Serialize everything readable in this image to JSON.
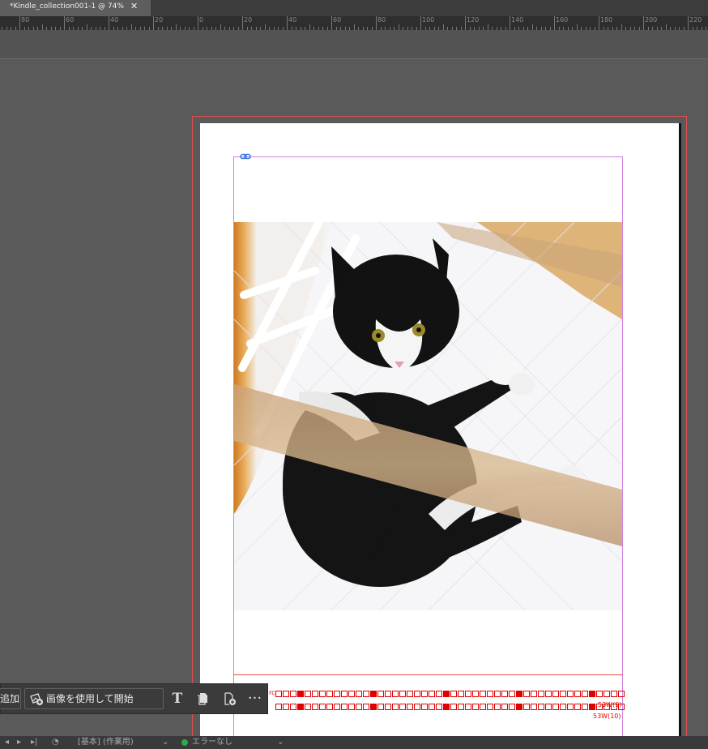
{
  "document": {
    "tab_title": "*Kindle_collection001-1 @ 74%",
    "close_glyph": "✕"
  },
  "ruler": {
    "labels": [
      "80",
      "60",
      "40",
      "20",
      "0",
      "20",
      "40",
      "60",
      "80",
      "100",
      "120",
      "140",
      "160",
      "180",
      "200",
      "220"
    ]
  },
  "canvas": {
    "photo_subject": "black-and-white cat on white quilted cloth",
    "grid_label_top": "53W(9)",
    "grid_label_bottom": "53W(10)",
    "grid_prefix": "rc"
  },
  "context_toolbar": {
    "add_label": "追加",
    "start_with_image_label": "画像を使用して開始",
    "text_icon": "T",
    "more_glyph": "•••"
  },
  "status_bar": {
    "workspace_label": "[基本] (作業用)",
    "preflight_label": "エラーなし"
  },
  "colors": {
    "bleed_guide": "#e05050",
    "margin_guide": "#d080e0",
    "grid_red": "#e00000",
    "status_ok": "#2fa84f"
  }
}
